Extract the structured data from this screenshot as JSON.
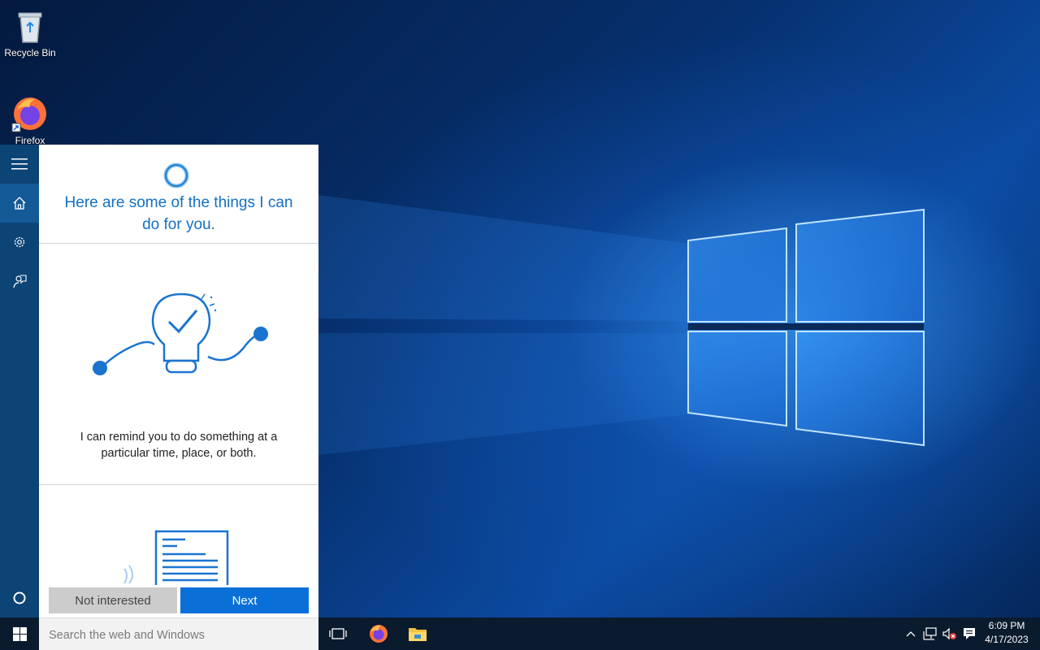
{
  "desktop": {
    "icons": [
      {
        "label": "Recycle Bin",
        "icon": "recycle-bin-icon"
      },
      {
        "label": "Firefox",
        "icon": "firefox-icon"
      }
    ]
  },
  "cortana": {
    "heading_line1": "Here are some of the things I can",
    "heading_line2": "do for you.",
    "caption_line1": "I can remind you to do something at a",
    "caption_line2": "particular time, place, or both.",
    "not_interested_label": "Not interested",
    "next_label": "Next",
    "rail_icons": [
      "hamburger-menu-icon",
      "home-icon",
      "gear-icon",
      "feedback-icon",
      "cortana-circle-icon"
    ]
  },
  "taskbar": {
    "search_placeholder": "Search the web and Windows",
    "time": "6:09 PM",
    "date": "4/17/2023",
    "pinned": [
      "task-view-icon",
      "firefox-icon",
      "file-explorer-icon"
    ],
    "tray": [
      "chevron-up-icon",
      "network-icon",
      "volume-muted-icon",
      "action-center-icon"
    ]
  },
  "colors": {
    "cortana_blue": "#1470c2",
    "rail": "#0c4476",
    "next_button": "#0a70d8",
    "taskbar": "#0b1b2e"
  }
}
